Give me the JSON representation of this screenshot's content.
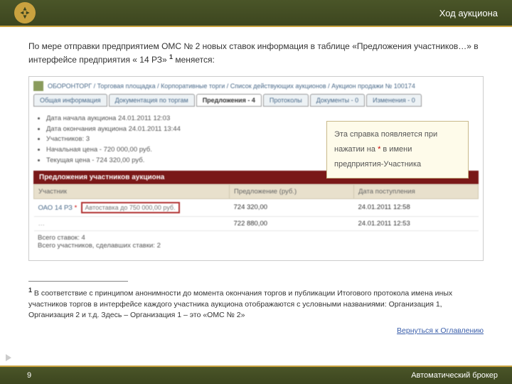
{
  "header": {
    "title": "Ход аукциона"
  },
  "intro": {
    "t1": "По мере отправки предприятием ОМС № 2 новых ставок информация в таблице «Предложения участников…» в интерфейсе предприятия « 14 РЗ» ",
    "sup": "1",
    "t2": " меняется:"
  },
  "screenshot": {
    "breadcrumb": "ОБОРОНТОРГ / Торговая площадка / Корпоративные торги / Список действующих аукционов / Аукцион продажи № 100174",
    "tabs": [
      "Общая информация",
      "Документация по торгам",
      "Предложения - 4",
      "Протоколы",
      "Документы - 0",
      "Изменения - 0"
    ],
    "active_tab": 2,
    "info": [
      "Дата начала аукциона 24.01.2011 12:03",
      "Дата окончания аукциона 24.01.2011 13:44",
      "Участников: 3",
      "Начальная цена - 720 000,00 руб.",
      "Текущая цена - 724 320,00 руб."
    ],
    "section_title": "Предложения участников аукциона",
    "cols": [
      "Участник",
      "Предложение (руб.)",
      "Дата поступления"
    ],
    "row": {
      "name": "ОАО 14 РЗ",
      "star": "*",
      "boxed": "Автоставка до 750 000,00 руб.",
      "bid": "724 320,00",
      "date": "24.01.2011 12:58"
    },
    "summary": {
      "l1": "Всего ставок: 4",
      "l2": "Всего участников, сделавших ставки: 2",
      "r1": "722 880,00",
      "r2": "24.01.2011 12:53"
    }
  },
  "callout": {
    "l1": "Эта справка появляется при",
    "l2a": "нажатии на ",
    "l2b": " в имени",
    "l3": "предприятия-Участника"
  },
  "footnote": {
    "sup": "1",
    "text": " В соответствие с принципом анонимности до момента окончания торгов и публикации Итогового протокола имена иных участников торгов в интерфейсе каждого участника аукциона отображаются с условными названиями: Организация 1, Организация 2  и т.д.  Здесь – Организация 1 – это «ОМС № 2»"
  },
  "back_link": "Вернуться к Оглавлению",
  "footer": {
    "page": "9",
    "right": "Автоматический брокер"
  }
}
